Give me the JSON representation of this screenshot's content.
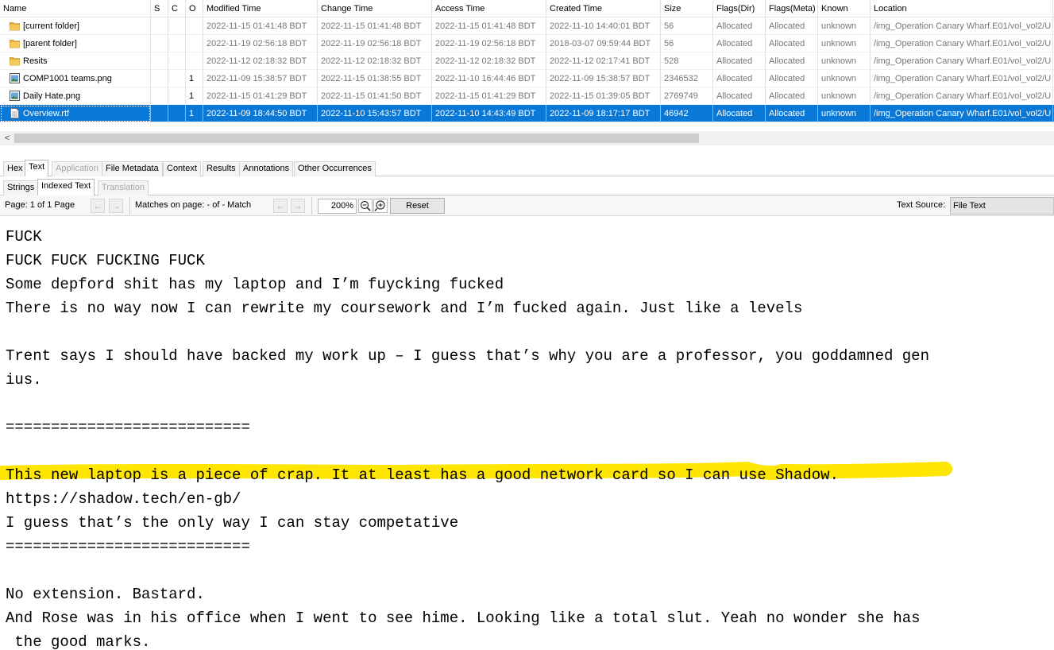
{
  "table": {
    "headers": {
      "name": "Name",
      "s": "S",
      "c": "C",
      "o": "O",
      "modified": "Modified Time",
      "change": "Change Time",
      "access": "Access Time",
      "created": "Created Time",
      "size": "Size",
      "flags_dir": "Flags(Dir)",
      "flags_meta": "Flags(Meta)",
      "known": "Known",
      "location": "Location"
    },
    "rows": [
      {
        "name": "[current folder]",
        "icon": "folder-icon",
        "s": "",
        "c": "",
        "o": "",
        "modified": "2022-11-15 01:41:48 BDT",
        "change": "2022-11-15 01:41:48 BDT",
        "access": "2022-11-15 01:41:48 BDT",
        "created": "2022-11-10 14:40:01 BDT",
        "size": "56",
        "flags_dir": "Allocated",
        "flags_meta": "Allocated",
        "known": "unknown",
        "location": "/img_Operation Canary Wharf.E01/vol_vol2/U"
      },
      {
        "name": "[parent folder]",
        "icon": "folder-icon",
        "s": "",
        "c": "",
        "o": "",
        "modified": "2022-11-19 02:56:18 BDT",
        "change": "2022-11-19 02:56:18 BDT",
        "access": "2022-11-19 02:56:18 BDT",
        "created": "2018-03-07 09:59:44 BDT",
        "size": "56",
        "flags_dir": "Allocated",
        "flags_meta": "Allocated",
        "known": "unknown",
        "location": "/img_Operation Canary Wharf.E01/vol_vol2/U"
      },
      {
        "name": "Resits",
        "icon": "folder-icon",
        "s": "",
        "c": "",
        "o": "",
        "modified": "2022-11-12 02:18:32 BDT",
        "change": "2022-11-12 02:18:32 BDT",
        "access": "2022-11-12 02:18:32 BDT",
        "created": "2022-11-12 02:17:41 BDT",
        "size": "528",
        "flags_dir": "Allocated",
        "flags_meta": "Allocated",
        "known": "unknown",
        "location": "/img_Operation Canary Wharf.E01/vol_vol2/U"
      },
      {
        "name": "COMP1001 teams.png",
        "icon": "image-file-icon",
        "s": "",
        "c": "",
        "o": "1",
        "modified": "2022-11-09 15:38:57 BDT",
        "change": "2022-11-15 01:38:55 BDT",
        "access": "2022-11-10 16:44:46 BDT",
        "created": "2022-11-09 15:38:57 BDT",
        "size": "2346532",
        "flags_dir": "Allocated",
        "flags_meta": "Allocated",
        "known": "unknown",
        "location": "/img_Operation Canary Wharf.E01/vol_vol2/U"
      },
      {
        "name": "Daily Hate.png",
        "icon": "image-file-icon",
        "s": "",
        "c": "",
        "o": "1",
        "modified": "2022-11-15 01:41:29 BDT",
        "change": "2022-11-15 01:41:50 BDT",
        "access": "2022-11-15 01:41:29 BDT",
        "created": "2022-11-15 01:39:05 BDT",
        "size": "2769749",
        "flags_dir": "Allocated",
        "flags_meta": "Allocated",
        "known": "unknown",
        "location": "/img_Operation Canary Wharf.E01/vol_vol2/U"
      },
      {
        "name": "Overview.rtf",
        "icon": "document-file-icon",
        "s": "",
        "c": "",
        "o": "1",
        "modified": "2022-11-09 18:44:50 BDT",
        "change": "2022-11-10 15:43:57 BDT",
        "access": "2022-11-10 14:43:49 BDT",
        "created": "2022-11-09 18:17:17 BDT",
        "size": "46942",
        "flags_dir": "Allocated",
        "flags_meta": "Allocated",
        "known": "unknown",
        "location": "/img_Operation Canary Wharf.E01/vol_vol2/U",
        "selected": true
      }
    ]
  },
  "scroll_left_glyph": "<",
  "tabs": [
    {
      "label": "Hex"
    },
    {
      "label": "Text",
      "active": true
    },
    {
      "label": "Application",
      "disabled": true
    },
    {
      "label": "File Metadata"
    },
    {
      "label": "Context"
    },
    {
      "label": "Results"
    },
    {
      "label": "Annotations"
    },
    {
      "label": "Other Occurrences"
    }
  ],
  "subtabs": [
    {
      "label": "Strings"
    },
    {
      "label": "Indexed Text",
      "active": true
    },
    {
      "label": "Translation",
      "disabled": true
    }
  ],
  "toolbar": {
    "page_text": "Page:  1 of  1 Page",
    "matches_text": "Matches on page:  -  of  -  Match",
    "zoom": "200%",
    "reset": "Reset",
    "text_source_label": "Text Source:",
    "text_source_value": "File Text",
    "prev_glyph": "←",
    "next_glyph": "→"
  },
  "text_lines": [
    "FUCK",
    "FUCK FUCK FUCKING FUCK",
    "Some depford shit has my laptop and I’m fuycking fucked",
    "There is no way now I can rewrite my coursework and I’m fucked again. Just like a levels",
    "",
    "Trent says I should have backed my work up – I guess that’s why you are a professor, you goddamned gen",
    "ius.",
    "",
    "===========================",
    "",
    "This new laptop is a piece of crap. It at least has a good network card so I can use Shadow.",
    "https://shadow.tech/en-gb/",
    "I guess that’s the only way I can stay competative",
    "===========================",
    "",
    "No extension. Bastard.",
    "And Rose was in his office when I went to see hime. Looking like a total slut. Yeah no wonder she has",
    " the good marks."
  ],
  "colors": {
    "selection": "#0a78d7",
    "highlight": "#ffe600",
    "folder": "#e8b33c"
  }
}
